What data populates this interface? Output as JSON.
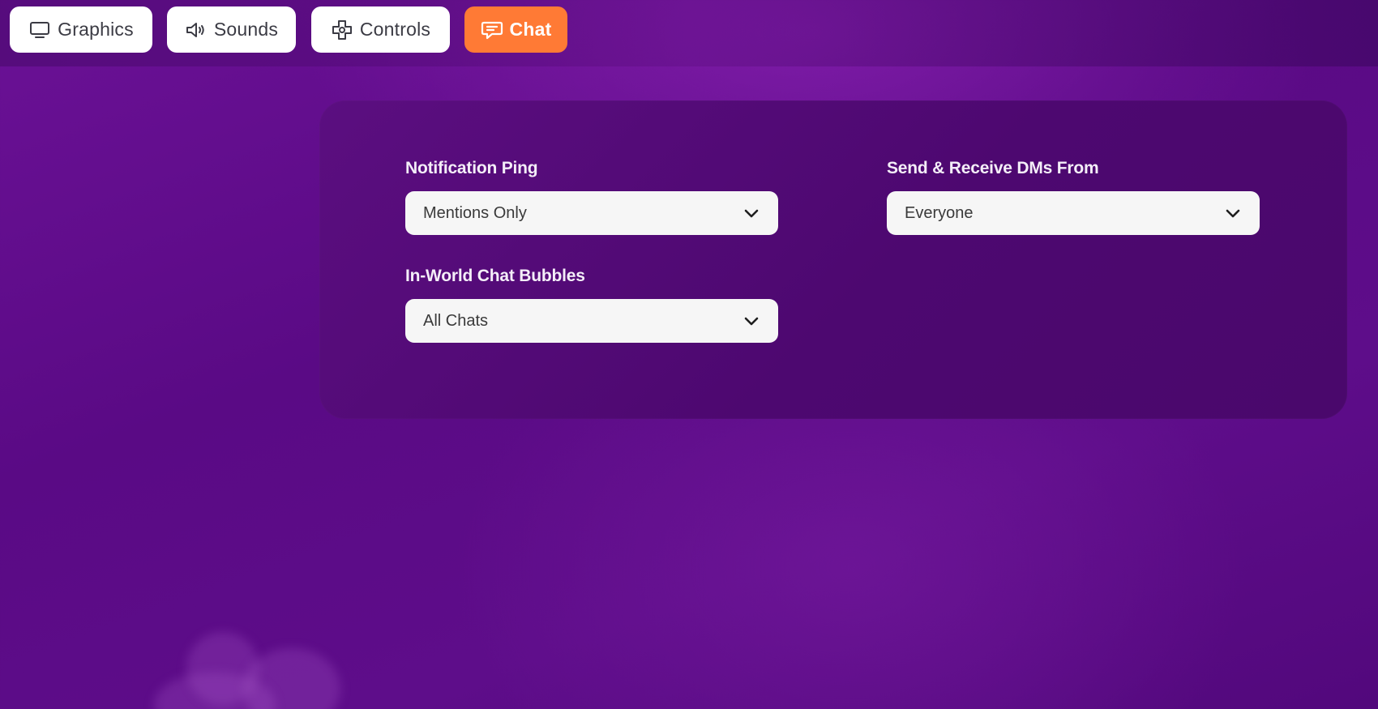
{
  "tabs": [
    {
      "id": "graphics",
      "label": "Graphics",
      "icon": "monitor-icon",
      "active": false
    },
    {
      "id": "sounds",
      "label": "Sounds",
      "icon": "speaker-icon",
      "active": false
    },
    {
      "id": "controls",
      "label": "Controls",
      "icon": "gamepad-icon",
      "active": false
    },
    {
      "id": "chat",
      "label": "Chat",
      "icon": "chat-bubble-icon",
      "active": true
    }
  ],
  "chat_settings": {
    "notification_ping": {
      "label": "Notification Ping",
      "value": "Mentions Only"
    },
    "dms_from": {
      "label": "Send & Receive DMs From",
      "value": "Everyone"
    },
    "chat_bubbles": {
      "label": "In-World Chat Bubbles",
      "value": "All Chats"
    }
  },
  "colors": {
    "accent": "#ff7a35",
    "background": "#5e0d8a",
    "panel": "#4f0a74",
    "tab_background": "#ffffff",
    "select_background": "#f6f6f6"
  }
}
